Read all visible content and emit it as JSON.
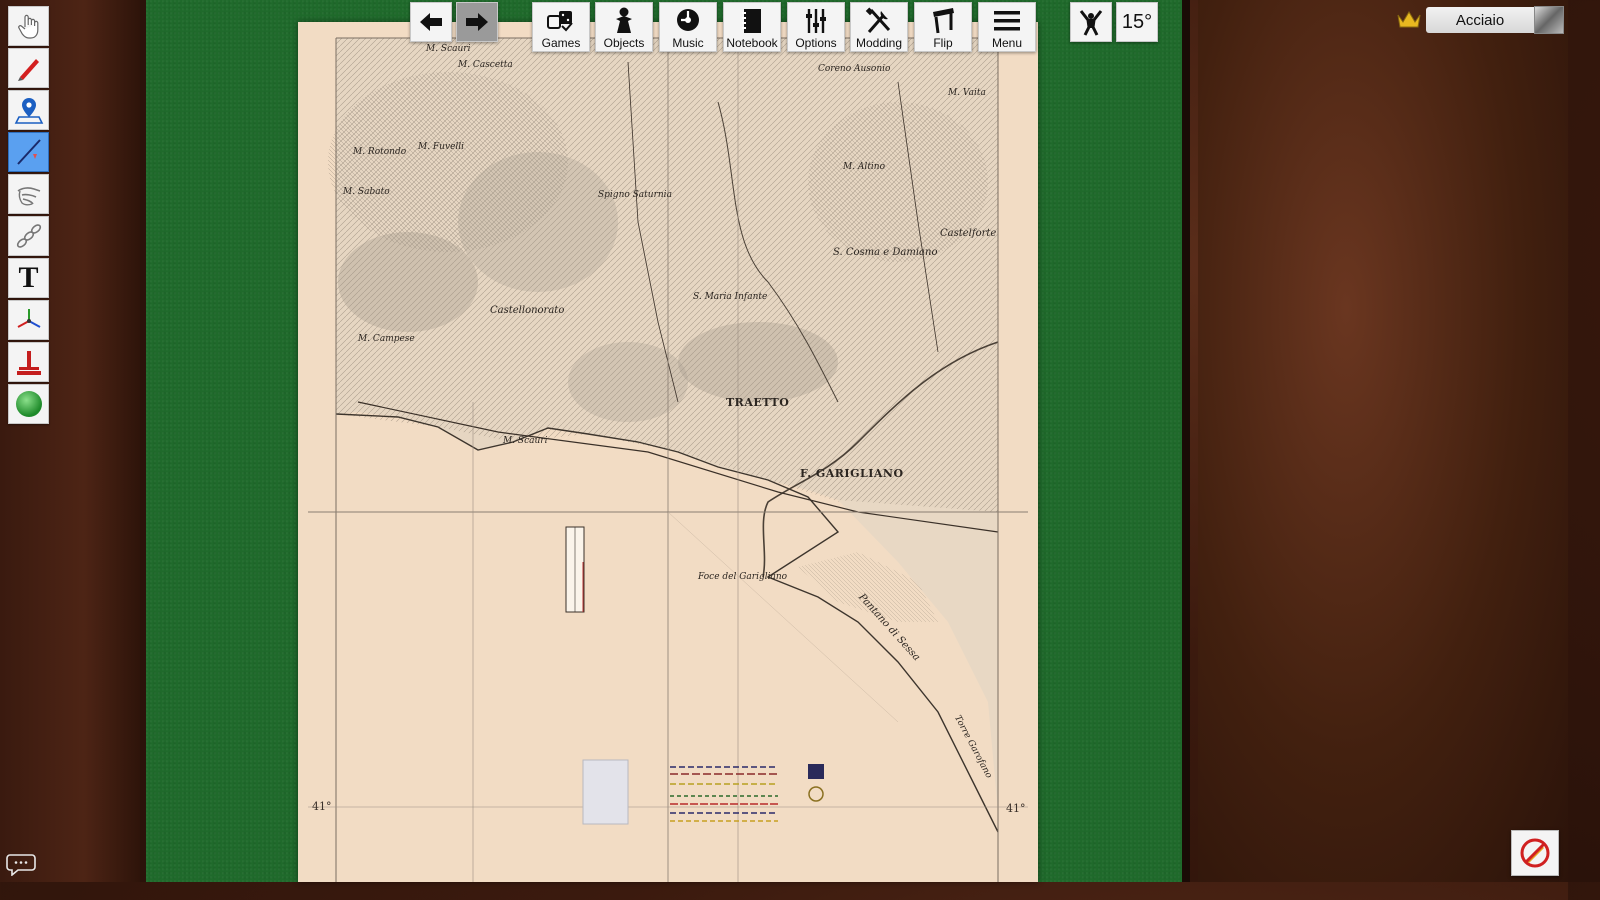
{
  "toolbar": {
    "tools": [
      {
        "icon": "grab-hand-icon",
        "active": false
      },
      {
        "icon": "pen-icon",
        "active": false
      },
      {
        "icon": "map-pin-icon",
        "active": false
      },
      {
        "icon": "line-tool-icon",
        "active": true
      },
      {
        "icon": "flick-hand-icon",
        "active": false
      },
      {
        "icon": "joint-icon",
        "active": false
      },
      {
        "icon": "text-tool-icon",
        "active": false
      },
      {
        "icon": "gizmo-icon",
        "active": false
      },
      {
        "icon": "snap-point-icon",
        "active": false
      },
      {
        "icon": "zone-sphere-icon",
        "active": false
      }
    ],
    "text_glyph": "T"
  },
  "top_menu": {
    "back_icon": "arrow-left-icon",
    "forward_icon": "arrow-right-icon",
    "items": [
      {
        "label": "Games",
        "icon": "games-icon"
      },
      {
        "label": "Objects",
        "icon": "objects-icon"
      },
      {
        "label": "Music",
        "icon": "music-icon"
      },
      {
        "label": "Notebook",
        "icon": "notebook-icon"
      },
      {
        "label": "Options",
        "icon": "options-icon"
      },
      {
        "label": "Modding",
        "icon": "modding-icon"
      },
      {
        "label": "Flip",
        "icon": "flip-table-icon"
      },
      {
        "label": "Menu",
        "icon": "hamburger-icon"
      }
    ],
    "flex_icon": "flex-control-icon",
    "rotation": "15°"
  },
  "player": {
    "name": "Acciaio",
    "host_icon": "crown-icon",
    "avatar_icon": "avatar-icon"
  },
  "map": {
    "labels": [
      {
        "text": "M. Scauri",
        "size": "small"
      },
      {
        "text": "M. Cascetta",
        "size": "small"
      },
      {
        "text": "Coreno Ausonio",
        "size": "small"
      },
      {
        "text": "M. Vaita",
        "size": "small"
      },
      {
        "text": "M. Fuvelli",
        "size": "small"
      },
      {
        "text": "M. Rotondo",
        "size": "small"
      },
      {
        "text": "M. Altino",
        "size": "small"
      },
      {
        "text": "M. Sabato",
        "size": "small"
      },
      {
        "text": "Spigno Saturnia",
        "size": "small"
      },
      {
        "text": "S. Cosma e Damiano",
        "size": "med"
      },
      {
        "text": "Castelforte",
        "size": "med"
      },
      {
        "text": "Castellonorato",
        "size": "med"
      },
      {
        "text": "S. Maria Infante",
        "size": "small"
      },
      {
        "text": "M. Campese",
        "size": "small"
      },
      {
        "text": "TRAETTO",
        "size": "big"
      },
      {
        "text": "M. Scauri",
        "size": "small"
      },
      {
        "text": "F. GARIGLIANO",
        "size": "big"
      },
      {
        "text": "Foce del Garigliano",
        "size": "small"
      },
      {
        "text": "Pantano di Sessa",
        "size": "med"
      },
      {
        "text": "Torre Garofano",
        "size": "small"
      }
    ],
    "coord_left": "41°",
    "coord_right": "41°"
  },
  "bottom": {
    "chat_icon": "chat-bubble-icon",
    "no_edit_icon": "no-edit-icon"
  }
}
